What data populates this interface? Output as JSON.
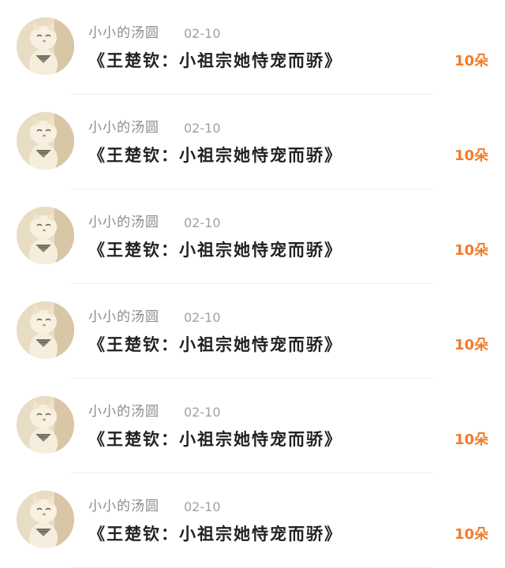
{
  "colors": {
    "count_orange": "#f37b28",
    "name_gray": "#8c8c8c",
    "title_black": "#222222"
  },
  "rows": [
    {
      "avatar": "kitten-avatar",
      "name": "小小的汤圆",
      "date": "02-10",
      "title": "《王楚钦：小祖宗她恃宠而骄》",
      "count": "10朵"
    },
    {
      "avatar": "kitten-avatar",
      "name": "小小的汤圆",
      "date": "02-10",
      "title": "《王楚钦：小祖宗她恃宠而骄》",
      "count": "10朵"
    },
    {
      "avatar": "kitten-avatar",
      "name": "小小的汤圆",
      "date": "02-10",
      "title": "《王楚钦：小祖宗她恃宠而骄》",
      "count": "10朵"
    },
    {
      "avatar": "kitten-avatar",
      "name": "小小的汤圆",
      "date": "02-10",
      "title": "《王楚钦：小祖宗她恃宠而骄》",
      "count": "10朵"
    },
    {
      "avatar": "kitten-avatar",
      "name": "小小的汤圆",
      "date": "02-10",
      "title": "《王楚钦：小祖宗她恃宠而骄》",
      "count": "10朵"
    },
    {
      "avatar": "kitten-avatar",
      "name": "小小的汤圆",
      "date": "02-10",
      "title": "《王楚钦：小祖宗她恃宠而骄》",
      "count": "10朵"
    }
  ]
}
